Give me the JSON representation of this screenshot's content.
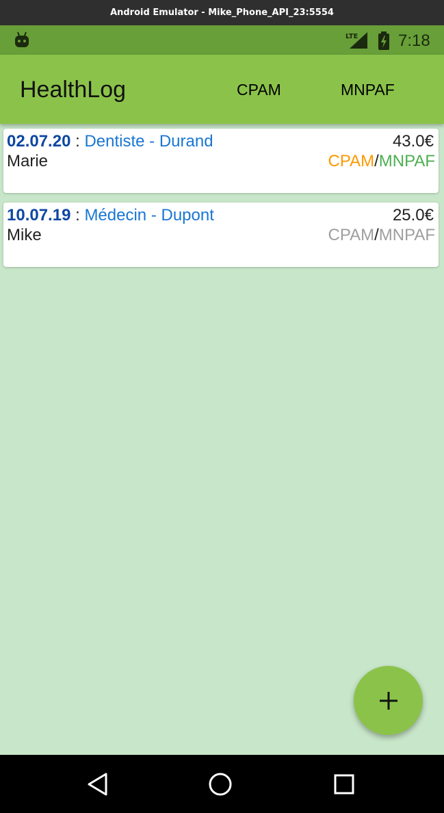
{
  "window": {
    "title": "Android Emulator - Mike_Phone_API_23:5554"
  },
  "status_bar": {
    "time": "7:18",
    "network_label": "LTE",
    "icons": [
      "android-icon",
      "lte-signal-icon",
      "battery-charging-icon"
    ]
  },
  "app_bar": {
    "title": "HealthLog",
    "actions": [
      "CPAM",
      "MNPAF"
    ]
  },
  "colors": {
    "app_bar": "#8bc34a",
    "status_bar": "#689f38",
    "background": "#c8e6c9",
    "date": "#0d47a1",
    "link": "#1976d2",
    "reimbursed_cpam": "#ff9800",
    "reimbursed_mnpaf": "#4caf50",
    "pending": "#9e9e9e"
  },
  "entries": [
    {
      "date": "02.07.20",
      "sep": ":",
      "type": "Dentiste",
      "dash": "-",
      "practitioner": "Durand",
      "amount": "43.0€",
      "patient": "Marie",
      "cpam": "CPAM",
      "slash": "/",
      "mnpaf": "MNPAF",
      "cpam_color": "#ff9800",
      "mnpaf_color": "#4caf50"
    },
    {
      "date": "10.07.19",
      "sep": ":",
      "type": "Médecin",
      "dash": "-",
      "practitioner": "Dupont",
      "amount": "25.0€",
      "patient": "Mike",
      "cpam": "CPAM",
      "slash": "/",
      "mnpaf": "MNPAF",
      "cpam_color": "#9e9e9e",
      "mnpaf_color": "#9e9e9e"
    }
  ],
  "fab": {
    "icon": "add-icon"
  },
  "nav_bar": {
    "icons": [
      "back-icon",
      "home-icon",
      "recents-icon"
    ]
  }
}
